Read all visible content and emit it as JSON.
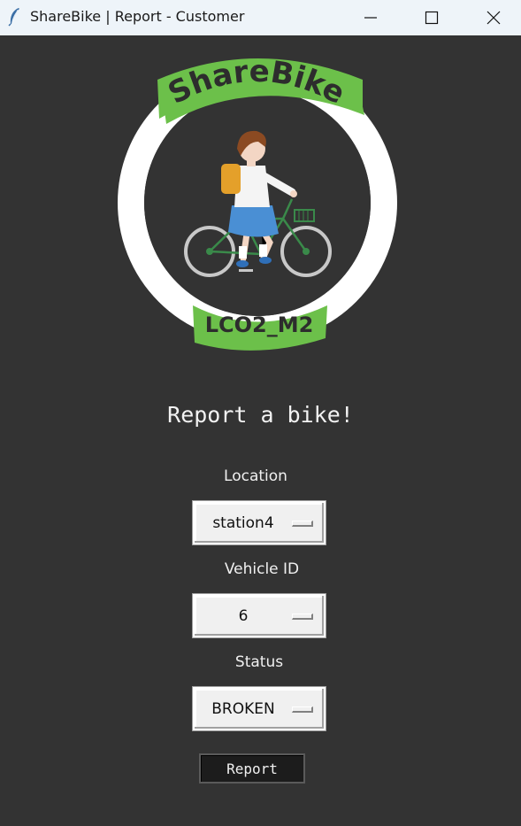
{
  "window": {
    "title": "ShareBike | Report - Customer"
  },
  "logo": {
    "top_text": "ShareBike",
    "bottom_text": "LCO2_M2"
  },
  "form": {
    "heading": "Report a bike!",
    "location": {
      "label": "Location",
      "value": "station4"
    },
    "vehicle": {
      "label": "Vehicle ID",
      "value": "6"
    },
    "status": {
      "label": "Status",
      "value": "BROKEN"
    },
    "submit_label": "Report"
  },
  "colors": {
    "background": "#333333",
    "logo_green": "#6cc04a",
    "logo_ring": "#ffffff"
  }
}
